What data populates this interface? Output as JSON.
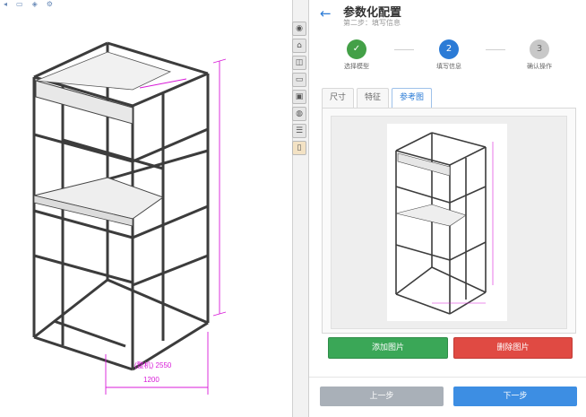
{
  "panel": {
    "title": "参数化配置",
    "subtitle": "第二步：填写信息",
    "back_icon": "arrow-left-icon"
  },
  "steps": [
    {
      "number": "✓",
      "label": "选择模型",
      "state": "done"
    },
    {
      "number": "2",
      "label": "填写信息",
      "state": "active"
    },
    {
      "number": "3",
      "label": "确认操作",
      "state": "todo"
    }
  ],
  "tabs": [
    {
      "label": "尺寸",
      "active": false
    },
    {
      "label": "特征",
      "active": false
    },
    {
      "label": "参考图",
      "active": true
    }
  ],
  "buttons": {
    "add_image": "添加图片",
    "delete_image": "删除图片",
    "prev": "上一步",
    "next": "下一步"
  },
  "cad_dims": {
    "dim_a": "(整机) 2550",
    "dim_b": "1200"
  },
  "colors": {
    "accent": "#2b7bd6",
    "success": "#3aa757",
    "danger": "#e04a43",
    "dimension": "#d81bd8"
  },
  "strip_icons": [
    "globe-icon",
    "home-icon",
    "cube-icon",
    "folder-icon",
    "image-icon",
    "color-wheel-icon",
    "list-icon",
    "property-icon"
  ]
}
